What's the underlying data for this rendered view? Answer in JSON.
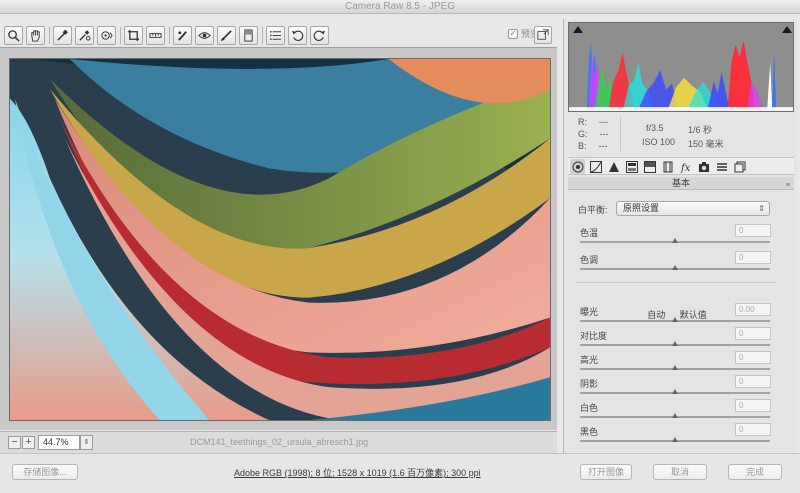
{
  "window": {
    "title": "Camera Raw 8.5 -  JPEG"
  },
  "toolbar": {
    "tools": [
      {
        "name": "zoom-tool",
        "icon": "magnifier-icon"
      },
      {
        "name": "hand-tool",
        "icon": "hand-icon"
      },
      {
        "name": "white-balance-tool",
        "icon": "eyedropper-icon"
      },
      {
        "name": "color-sampler-tool",
        "icon": "color-sampler-icon"
      },
      {
        "name": "targeted-adjustment-tool",
        "icon": "target-adjust-icon"
      },
      {
        "name": "crop-tool",
        "icon": "crop-icon"
      },
      {
        "name": "straighten-tool",
        "icon": "straighten-icon"
      },
      {
        "name": "spot-removal-tool",
        "icon": "spot-brush-icon"
      },
      {
        "name": "red-eye-tool",
        "icon": "eye-icon"
      },
      {
        "name": "adjustment-brush-tool",
        "icon": "brush-icon"
      },
      {
        "name": "graduated-filter-tool",
        "icon": "gradient-icon"
      },
      {
        "name": "preferences-tool",
        "icon": "list-icon"
      },
      {
        "name": "rotate-left-tool",
        "icon": "rotate-ccw-icon"
      },
      {
        "name": "rotate-right-tool",
        "icon": "rotate-cw-icon"
      }
    ],
    "preview_checked": "✓",
    "preview_label": "预览"
  },
  "status": {
    "zoom_out": "−",
    "zoom_in": "+",
    "zoom_value": "44.7%",
    "zoom_arrow": "⇕",
    "filename": "DCM141_teethings_02_ursula_abresch1.jpg"
  },
  "histogram": {
    "shadow_clip_color": "#1a1a1a",
    "highlight_clip_color": "#1a1a1a"
  },
  "info": {
    "r_label": "R:",
    "r_value": "---",
    "g_label": "G:",
    "g_value": "---",
    "b_label": "B:",
    "b_value": "---",
    "aperture": "f/3.5",
    "shutter": "1/6 秒",
    "iso": "ISO 100",
    "focal": "150 毫米"
  },
  "panel_tabs": [
    "basic-icon",
    "tone-curve-icon",
    "detail-icon",
    "hsl-icon",
    "split-toning-icon",
    "lens-icon",
    "fx-icon",
    "camera-calibration-icon",
    "presets-icon",
    "snapshots-icon"
  ],
  "basic": {
    "section_title": "基本",
    "menu_icon": "≡",
    "wb_label": "白平衡:",
    "wb_value": "原照设置",
    "wb_arrow": "⇕",
    "auto_label": "自动",
    "default_label": "默认值",
    "sliders": {
      "temperature": {
        "label": "色温",
        "value": "0",
        "position": 0.5
      },
      "tint": {
        "label": "色调",
        "value": "0",
        "position": 0.5
      },
      "exposure": {
        "label": "曝光",
        "value": "0.00",
        "position": 0.5
      },
      "contrast": {
        "label": "对比度",
        "value": "0",
        "position": 0.5
      },
      "highlights": {
        "label": "高光",
        "value": "0",
        "position": 0.5
      },
      "shadows": {
        "label": "阴影",
        "value": "0",
        "position": 0.5
      },
      "whites": {
        "label": "白色",
        "value": "0",
        "position": 0.5
      },
      "blacks": {
        "label": "黑色",
        "value": "0",
        "position": 0.5
      }
    }
  },
  "bottom": {
    "save_label": "存储图像...",
    "workflow_text": "Adobe RGB (1998); 8 位; 1528 x 1019 (1.6 百万像素); 300 ppi",
    "open_label": "打开图像",
    "cancel_label": "取消",
    "done_label": "完成"
  }
}
